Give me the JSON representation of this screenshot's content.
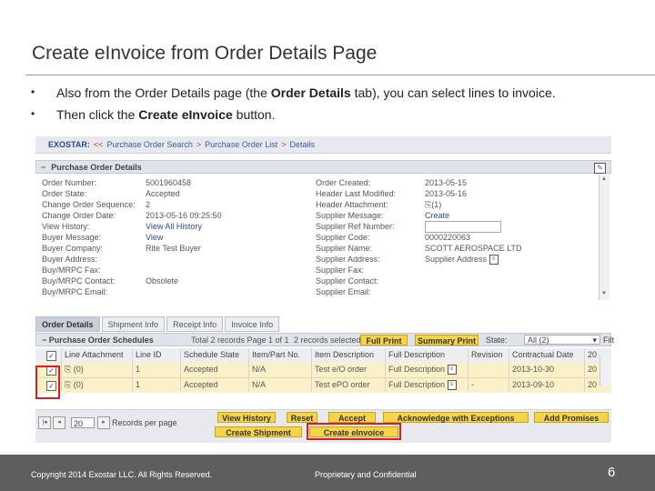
{
  "slide": {
    "title": "Create eInvoice from Order Details Page",
    "bullets": [
      {
        "pre": "Also from the Order Details page (the ",
        "bold": "Order Details",
        "post": " tab), you can select lines to invoice."
      },
      {
        "pre": "Then click the ",
        "bold": "Create eInvoice",
        "post": " button."
      }
    ],
    "bullet_char": "•"
  },
  "breadcrumb": {
    "brand": "EXOSTAR:",
    "arrows": "<<",
    "items": [
      "Purchase Order Search",
      "Purchase Order List",
      "Details"
    ],
    "sep": ">"
  },
  "po_panel": {
    "title": "Purchase Order Details",
    "toggle": "−",
    "left": [
      {
        "label": "Order Number:",
        "value": "5001960458"
      },
      {
        "label": "Order State:",
        "value": "Accepted"
      },
      {
        "label": "Change Order Sequence:",
        "value": "2"
      },
      {
        "label": "Change Order Date:",
        "value": "2013-05-16 09:25:50"
      },
      {
        "label": "View History:",
        "value": "View All History"
      },
      {
        "label": "Buyer Message:",
        "value": "View"
      },
      {
        "label": "Buyer Company:",
        "value": "Rite Test Buyer"
      },
      {
        "label": "Buyer Address:",
        "value": ""
      },
      {
        "label": "Buy/MRPC Fax:",
        "value": ""
      },
      {
        "label": "Buy/MRPC Contact:",
        "value": "Obsolete"
      },
      {
        "label": "Buy/MRPC Email:",
        "value": ""
      }
    ],
    "right": [
      {
        "label": "Order Created:",
        "value": "2013-05-15"
      },
      {
        "label": "Header Last Modified:",
        "value": "2013-05-16"
      },
      {
        "label": "Header Attachment:",
        "value": "(1)"
      },
      {
        "label": "Supplier Message:",
        "value": "Create"
      },
      {
        "label": "Supplier Ref Number:",
        "value": ""
      },
      {
        "label": "Supplier Code:",
        "value": "0000220063"
      },
      {
        "label": "Supplier Name:",
        "value": "SCOTT AEROSPACE LTD"
      },
      {
        "label": "Supplier Address:",
        "value": "Supplier Address"
      },
      {
        "label": "Supplier Fax:",
        "value": ""
      },
      {
        "label": "Supplier Contact:",
        "value": ""
      },
      {
        "label": "Supplier Email:",
        "value": ""
      }
    ]
  },
  "tabs": [
    "Order Details",
    "Shipment Info",
    "Receipt Info",
    "Invoice Info"
  ],
  "schedules": {
    "title": "Purchase Order Schedules",
    "count_text": "Total 2 records Page 1 of 1",
    "selected_text": "2 records selected",
    "full_print": "Full Print",
    "summary_print": "Summary Print",
    "state_label": "State:",
    "state_value": "All (2)",
    "filter_label": "Filt",
    "columns": [
      "",
      "Line Attachment",
      "Line ID",
      "Schedule State",
      "Item/Part No.",
      "Item Description",
      "Full Description",
      "Revision",
      "Contractual Date",
      "20"
    ],
    "rows": [
      {
        "checked": "✓",
        "attachment": "(0)",
        "line_id": "1",
        "state": "Accepted",
        "part": "N/A",
        "item_desc": "Test e/O order",
        "full_desc": "Full Description",
        "revision": "",
        "date": "2013-10-30",
        "extra": "20"
      },
      {
        "checked": "✓",
        "attachment": "(0)",
        "line_id": "1",
        "state": "Accepted",
        "part": "N/A",
        "item_desc": "Test ePO order",
        "full_desc": "Full Description",
        "revision": "-",
        "date": "2013-09-10",
        "extra": "20"
      }
    ]
  },
  "actions": {
    "per_page_value": "20",
    "per_page_label": "Records per page",
    "view_history": "View History",
    "reset": "Reset",
    "accept": "Accept",
    "acknowledge": "Acknowledge with Exceptions",
    "add_promises": "Add Promises",
    "create_shipment": "Create Shipment",
    "create_einvoice": "Create eInvoice"
  },
  "footer": {
    "copyright": "Copyright 2014 Exostar LLC. All Rights Reserved.",
    "proprietary": "Proprietary and Confidential",
    "page_number": "6"
  },
  "colors": {
    "highlight_red": "#d42020",
    "button_yellow": "#f6d44a",
    "footer_gray": "#5e5e5e"
  }
}
